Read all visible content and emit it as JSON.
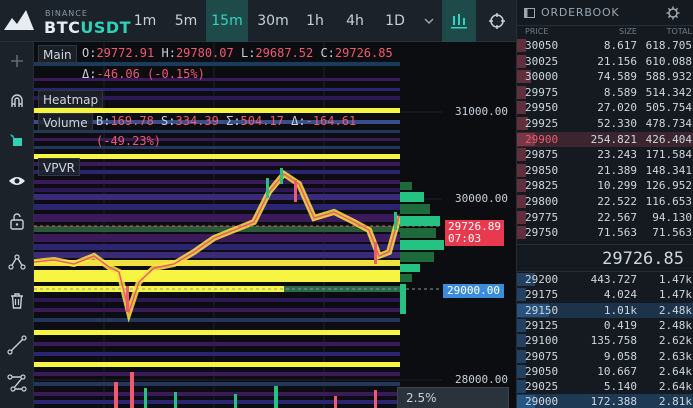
{
  "header": {
    "exchange": "BINANCE",
    "pair_base": "BTC",
    "pair_quote": "USDT",
    "timeframes": [
      "1m",
      "5m",
      "15m",
      "30m",
      "1h",
      "4h",
      "1D"
    ],
    "active_timeframe": "15m",
    "icons": [
      "chevron-down-icon",
      "indicators-icon",
      "crosshair-settings-icon"
    ]
  },
  "toolbar": {
    "tools": [
      "plus-icon",
      "magnet-icon",
      "cursor-box-icon",
      "eye-icon",
      "unlock-icon",
      "path-tool-icon",
      "trash-icon",
      "trendline-icon",
      "polyline-icon"
    ]
  },
  "chart": {
    "panes": {
      "main": "Main",
      "heatmap": "Heatmap",
      "volume": "Volume",
      "vpvr": "VPVR"
    },
    "ohlc": {
      "o_label": "O:",
      "o": "29772.91",
      "h_label": "H:",
      "h": "29780.07",
      "l_label": "L:",
      "l": "29687.52",
      "c_label": "C:",
      "c": "29726.85",
      "delta_label": "Δ:",
      "delta": "-46.06 (-0.15%)"
    },
    "volume": {
      "b_label": "B:",
      "b": "169.78",
      "s_label": "S:",
      "s": "334.39",
      "sum_label": "Σ:",
      "sum": "504.17",
      "delta_label": "Δ:",
      "delta": "-164.61",
      "delta_pct": "(-49.23%)"
    },
    "y_axis": [
      "31000.00",
      "30000.00",
      "29000.00",
      "28000.00"
    ],
    "last_price": "29726.89",
    "countdown": "07:03",
    "cursor_price": "29000.00",
    "zoom": "2.5%",
    "colors": {
      "up": "#26c281",
      "down": "#ef5a6f",
      "heat_high": "#f5f542",
      "heat_low": "#3b1a5c",
      "accent": "#2ed1b6"
    }
  },
  "orderbook": {
    "title": "ORDERBOOK",
    "columns": {
      "price": "PRICE",
      "size": "SIZE",
      "total": "TOTAL"
    },
    "asks": [
      {
        "price": "30050",
        "size": "8.617",
        "total": "618.705"
      },
      {
        "price": "30025",
        "size": "21.156",
        "total": "610.088"
      },
      {
        "price": "30000",
        "size": "74.589",
        "total": "588.932"
      },
      {
        "price": "29975",
        "size": "8.589",
        "total": "514.342"
      },
      {
        "price": "29950",
        "size": "27.020",
        "total": "505.754"
      },
      {
        "price": "29925",
        "size": "52.330",
        "total": "478.734"
      },
      {
        "price": "29900",
        "size": "254.821",
        "total": "426.404"
      },
      {
        "price": "29875",
        "size": "23.243",
        "total": "171.584"
      },
      {
        "price": "29850",
        "size": "21.389",
        "total": "148.341"
      },
      {
        "price": "29825",
        "size": "10.299",
        "total": "126.952"
      },
      {
        "price": "29800",
        "size": "22.522",
        "total": "116.653"
      },
      {
        "price": "29775",
        "size": "22.567",
        "total": "94.130"
      },
      {
        "price": "29750",
        "size": "71.563",
        "total": "71.563"
      }
    ],
    "mid_price": "29726.85",
    "bids": [
      {
        "price": "29200",
        "size": "443.727",
        "total": "1.47k"
      },
      {
        "price": "29175",
        "size": "4.024",
        "total": "1.47k"
      },
      {
        "price": "29150",
        "size": "1.01k",
        "total": "2.48k"
      },
      {
        "price": "29125",
        "size": "0.419",
        "total": "2.48k"
      },
      {
        "price": "29100",
        "size": "135.758",
        "total": "2.62k"
      },
      {
        "price": "29075",
        "size": "9.058",
        "total": "2.63k"
      },
      {
        "price": "29050",
        "size": "10.667",
        "total": "2.64k"
      },
      {
        "price": "29025",
        "size": "5.140",
        "total": "2.64k"
      },
      {
        "price": "29000",
        "size": "172.388",
        "total": "2.81k"
      }
    ]
  }
}
